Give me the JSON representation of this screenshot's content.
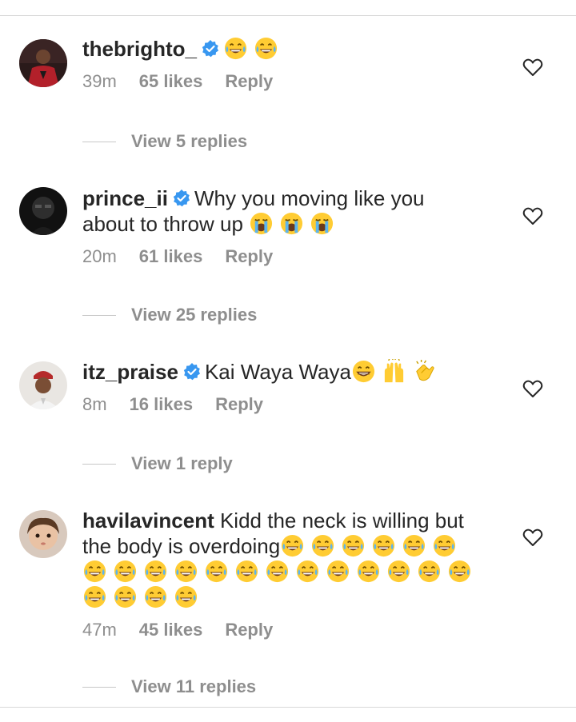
{
  "comments": [
    {
      "username": "thebrighto_",
      "verified": true,
      "text": "",
      "emojis_inline": [
        "joy",
        "joy"
      ],
      "time": "39m",
      "likes": "65 likes",
      "reply_label": "Reply",
      "view_replies": "View 5 replies"
    },
    {
      "username": "prince_ii",
      "verified": true,
      "text_line1": "Why you moving like you",
      "text_line2": "about to throw up",
      "emojis_inline": [
        "sob",
        "sob",
        "sob"
      ],
      "time": "20m",
      "likes": "61 likes",
      "reply_label": "Reply",
      "view_replies": "View 25 replies"
    },
    {
      "username": "itz_praise",
      "verified": true,
      "text": "Kai Waya Waya",
      "emojis_inline": [
        "grin",
        "raised-hands",
        "clap"
      ],
      "time": "8m",
      "likes": "16 likes",
      "reply_label": "Reply",
      "view_replies": "View 1 reply"
    },
    {
      "username": "havilavincent",
      "verified": false,
      "text_line1": "Kidd the neck is willing but",
      "text_line2": "the body is overdoing",
      "emojis_inline": [
        "joy",
        "joy",
        "joy",
        "joy",
        "joy",
        "joy",
        "joy",
        "joy",
        "joy",
        "joy",
        "joy",
        "joy",
        "joy",
        "joy",
        "joy",
        "joy",
        "joy",
        "joy",
        "joy",
        "joy",
        "joy",
        "joy",
        "joy"
      ],
      "time": "47m",
      "likes": "45 likes",
      "reply_label": "Reply",
      "view_replies": "View 11 replies"
    }
  ],
  "colors": {
    "text": "#262626",
    "muted": "#8e8e8e",
    "verified_blue": "#3897f0",
    "emoji_yellow": "#ffcc33",
    "tear_blue": "#5bb4ef"
  },
  "icons": {
    "like": "heart-outline-icon",
    "verified": "verified-badge-icon"
  }
}
